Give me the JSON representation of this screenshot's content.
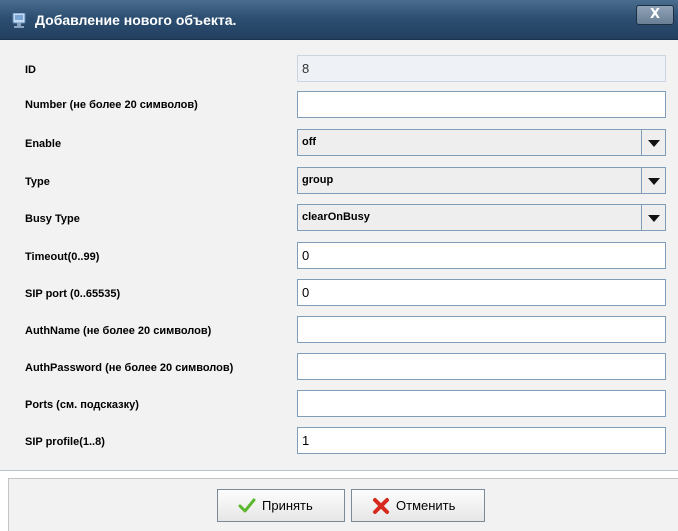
{
  "window": {
    "title": "Добавление нового объекта.",
    "close_label": "X"
  },
  "fields": {
    "id": {
      "label": "ID",
      "value": "8"
    },
    "number": {
      "label": "Number (не более 20 символов)",
      "value": ""
    },
    "enable": {
      "label": "Enable",
      "value": "off"
    },
    "type": {
      "label": "Type",
      "value": "group"
    },
    "busy_type": {
      "label": "Busy Type",
      "value": "clearOnBusy"
    },
    "timeout": {
      "label": "Timeout(0..99)",
      "value": "0"
    },
    "sip_port": {
      "label": "SIP port (0..65535)",
      "value": "0"
    },
    "auth_name": {
      "label": "AuthName (не более 20 символов)",
      "value": ""
    },
    "auth_password": {
      "label": "AuthPassword (не более 20 символов)",
      "value": ""
    },
    "ports": {
      "label": "Ports (см. подсказку)",
      "value": ""
    },
    "sip_profile": {
      "label": "SIP profile(1..8)",
      "value": "1"
    }
  },
  "buttons": {
    "accept": "Принять",
    "cancel": "Отменить"
  },
  "colors": {
    "titlebar": "#2d4f72",
    "accept_icon": "#5cb82e",
    "cancel_icon": "#d62a1f"
  }
}
